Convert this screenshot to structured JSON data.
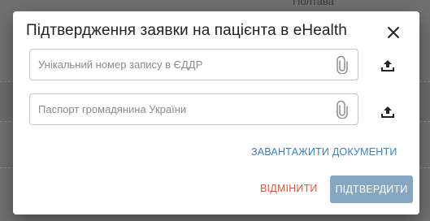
{
  "background": {
    "partial_text": "Полтава"
  },
  "dialog": {
    "title": "Підтвердження заявки на пацієнта в eHealth",
    "close_icon": "close-icon",
    "fields": [
      {
        "placeholder": "Унікальний номер запису в ЄДДР",
        "value": "",
        "attach_icon": "paperclip-icon",
        "upload_icon": "upload-icon"
      },
      {
        "placeholder": "Паспорт громадянина України",
        "value": "",
        "attach_icon": "paperclip-icon",
        "upload_icon": "upload-icon"
      }
    ],
    "upload_documents_label": "ЗАВАНТАЖИТИ ДОКУМЕНТИ",
    "cancel_label": "ВІДМІНИТИ",
    "confirm_label": "ПІДТВЕРДИТИ"
  },
  "colors": {
    "overlay": "#6f6f6f",
    "link_blue": "#3d7fb3",
    "cancel_red": "#d05a42",
    "confirm_disabled_bg": "#86a7c2"
  }
}
